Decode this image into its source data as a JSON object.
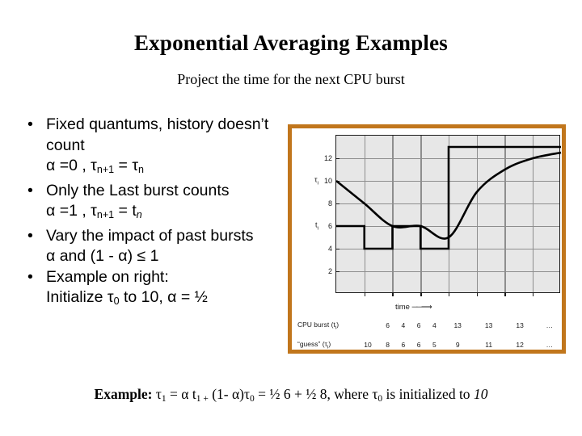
{
  "slide": {
    "title": "Exponential Averaging Examples",
    "subtitle": "Project the time for the next CPU burst"
  },
  "bullets": [
    {
      "marker": "•",
      "text": "Fixed quantums, history doesn’t count",
      "formula_plain": "α =0 , τn+1 = τn",
      "formula": {
        "a": "α =0 , τ",
        "sub1": "n+1",
        "b": " = τ",
        "sub2": "n"
      }
    },
    {
      "marker": "•",
      "text": "Only the Last burst counts",
      "formula_plain": "α =1 , τn+1 = tn",
      "formula": {
        "a": "α =1 , τ",
        "sub1": "n+1",
        "b": " = t",
        "sub2": "n"
      }
    },
    {
      "marker": "•",
      "text": "Vary the impact of past bursts",
      "formula_plain": "α and (1 - α) ≤ 1",
      "formula": {
        "a": "α and (1 - α) ≤ 1",
        "sub1": "",
        "b": "",
        "sub2": ""
      }
    },
    {
      "marker": "•",
      "text": "Example on right:",
      "formula_plain": "Initialize τ0 to 10, α = ½",
      "formula": {
        "a": "Initialize τ",
        "sub1": "0",
        "b": " to 10, α = ½",
        "sub2": ""
      }
    }
  ],
  "example": {
    "lead": "Example:",
    "part1": " τ",
    "sub1": "1",
    "part2": " = α t",
    "sub2": "1 +",
    "part3": " (1- α)τ",
    "sub3": "0",
    "part4": " = ½ 6 + ½ 8, where τ",
    "sub4": "0",
    "part5": " is initialized to ",
    "italic_value": "10"
  },
  "figure": {
    "frame_color": "#c1761c",
    "plot_bg": "#e7e7e7",
    "grid_color": "#8e8e8e",
    "line_color": "#000000",
    "time_label": "time",
    "time_arrow": "→",
    "y_side_labels": [
      {
        "text": "τ",
        "sub": "i",
        "value": 10
      },
      {
        "text": "t",
        "sub": "i",
        "value": 6
      }
    ],
    "table": {
      "rows": [
        {
          "label_text": "CPU burst (t",
          "label_sub": "i",
          "label_close": ")",
          "first": "",
          "values": [
            "6",
            "4",
            "6",
            "4",
            "13",
            "13",
            "13",
            "…"
          ]
        },
        {
          "label_text": "“guess” (τ",
          "label_sub": "i",
          "label_close": ")",
          "first": "10",
          "values": [
            "8",
            "6",
            "6",
            "5",
            "9",
            "11",
            "12",
            "…"
          ]
        }
      ]
    }
  },
  "chart_data": {
    "type": "line",
    "title": "",
    "xlabel": "time",
    "ylabel": "",
    "ylim": [
      0,
      14
    ],
    "yticks": [
      2,
      4,
      6,
      8,
      10,
      12
    ],
    "grid": true,
    "legend": "none",
    "series": [
      {
        "name": "CPU burst (t_i)",
        "style": "step",
        "x": [
          0,
          1,
          2,
          3,
          4,
          5,
          6,
          7,
          8
        ],
        "values": [
          6,
          4,
          6,
          4,
          13,
          13,
          13,
          13,
          13
        ]
      },
      {
        "name": "\"guess\" (tau_i)",
        "style": "smooth",
        "x": [
          0,
          1,
          2,
          3,
          4,
          5,
          6,
          7,
          8
        ],
        "values": [
          10,
          8,
          6,
          6,
          5,
          9,
          11,
          12,
          12.5
        ]
      }
    ]
  }
}
